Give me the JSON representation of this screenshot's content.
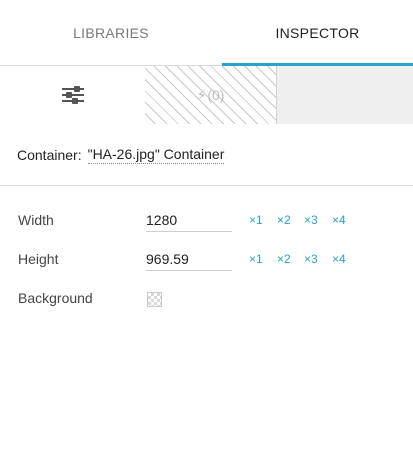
{
  "tabs": [
    {
      "label": "LIBRARIES",
      "active": false
    },
    {
      "label": "INSPECTOR",
      "active": true
    }
  ],
  "subtabs": {
    "properties_icon": "sliders-icon",
    "interactions_icon": "bolt-icon",
    "interactions_count": "(0)"
  },
  "container": {
    "prefix": "Container:",
    "name": "\"HA-26.jpg\" Container"
  },
  "properties": {
    "width": {
      "label": "Width",
      "value": "1280"
    },
    "height": {
      "label": "Height",
      "value": "969.59"
    },
    "background": {
      "label": "Background",
      "swatch": "transparent-checker"
    }
  },
  "multipliers": [
    "×1",
    "×2",
    "×3",
    "×4"
  ],
  "colors": {
    "accent": "#2aa3cc",
    "divider": "#dcdcdc",
    "text": "#222222"
  }
}
